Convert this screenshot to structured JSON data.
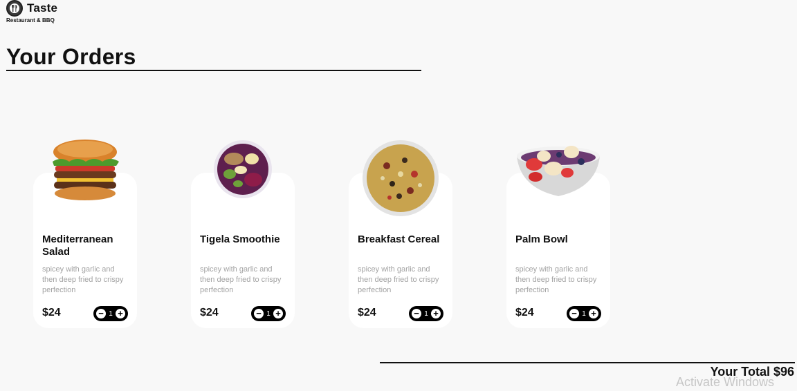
{
  "brand": {
    "name": "Taste",
    "tagline": "Restaurant & BBQ",
    "icon": "fork-knife-icon"
  },
  "page": {
    "title": "Your Orders"
  },
  "orders": [
    {
      "name": "Mediterranean Salad",
      "description": "spicey with garlic and then deep fried to crispy perfection",
      "price": "$24",
      "quantity": "1",
      "image": "burger-image"
    },
    {
      "name": "Tigela Smoothie",
      "description": "spicey with garlic and then deep fried to crispy perfection",
      "price": "$24",
      "quantity": "1",
      "image": "smoothie-bowl-image"
    },
    {
      "name": "Breakfast Cereal",
      "description": "spicey with garlic and then deep fried to crispy perfection",
      "price": "$24",
      "quantity": "1",
      "image": "cereal-bowl-image"
    },
    {
      "name": "Palm Bowl",
      "description": "spicey with garlic and then deep fried to crispy perfection",
      "price": "$24",
      "quantity": "1",
      "image": "fruit-bowl-image"
    }
  ],
  "stepper": {
    "minus": "−",
    "plus": "+"
  },
  "total": {
    "label": "Your Total $96"
  },
  "watermark": "Activate Windows"
}
